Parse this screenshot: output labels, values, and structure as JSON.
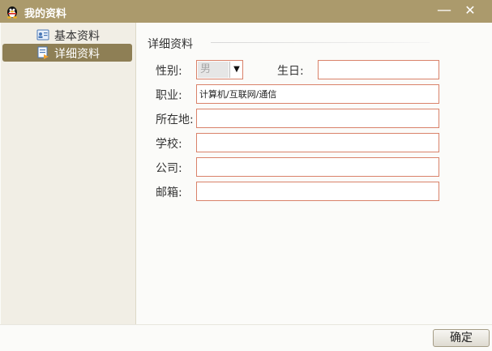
{
  "window": {
    "title": "我的资料",
    "minimize_glyph": "—",
    "close_glyph": "✕"
  },
  "sidebar": {
    "items": [
      {
        "label": "基本资料",
        "icon": "profile-card-icon",
        "selected": false
      },
      {
        "label": "详细资料",
        "icon": "detail-doc-icon",
        "selected": true
      }
    ]
  },
  "main": {
    "section_title": "详细资料",
    "gender": {
      "label": "性别:",
      "value": "男"
    },
    "birthday": {
      "label": "生日:",
      "value": ""
    },
    "occupation": {
      "label": "职业:",
      "value": "计算机/互联网/通信"
    },
    "location": {
      "label": "所在地:",
      "value": ""
    },
    "school": {
      "label": "学校:",
      "value": ""
    },
    "company": {
      "label": "公司:",
      "value": ""
    },
    "email": {
      "label": "邮箱:",
      "value": ""
    }
  },
  "footer": {
    "ok_label": "确定"
  },
  "colors": {
    "titlebar": "#ab9a6c",
    "selected_item": "#8e7f55",
    "field_border": "#d9826a",
    "sidebar_bg": "#f1eee5"
  }
}
